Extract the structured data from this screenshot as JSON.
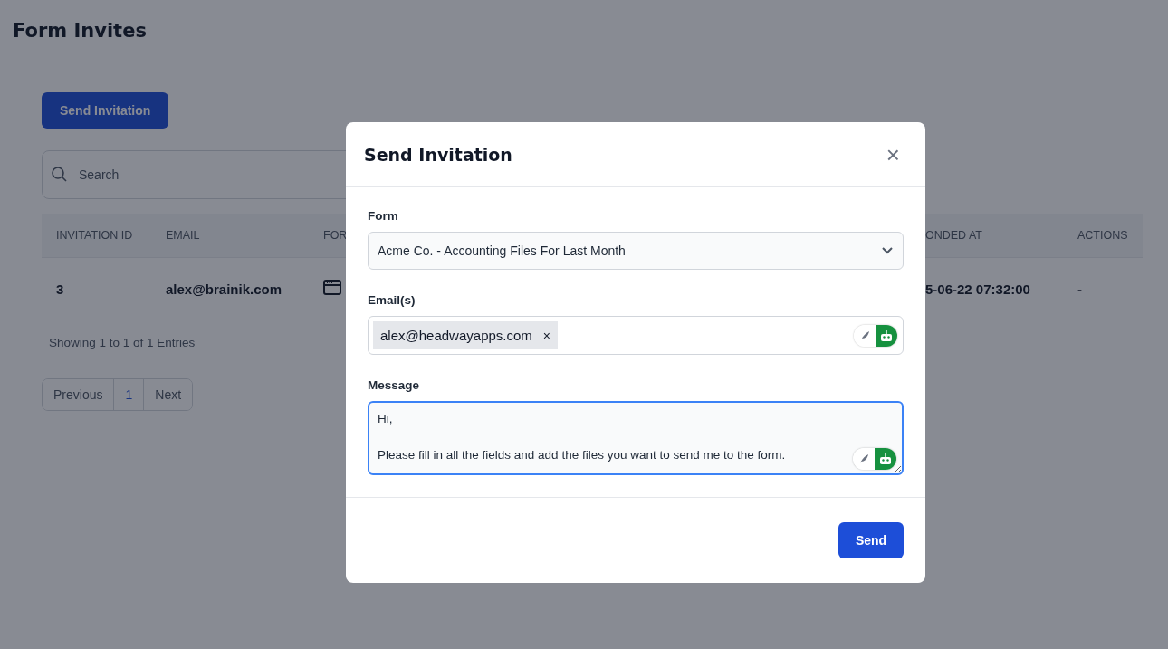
{
  "page": {
    "title": "Form Invites",
    "primary_button": "Send Invitation",
    "search": {
      "placeholder": "Search"
    }
  },
  "table": {
    "columns": [
      "INVITATION ID",
      "EMAIL",
      "FOR",
      "ONDED AT",
      "ACTIONS"
    ],
    "rows": [
      {
        "id": "3",
        "email": "alex@brainik.com",
        "responded_at": "5-06-22 07:32:00",
        "actions": "-"
      }
    ]
  },
  "summary": "Showing 1 to 1 of 1 Entries",
  "pagination": [
    {
      "label": "Previous",
      "selected": false
    },
    {
      "label": "1",
      "selected": true
    },
    {
      "label": "Next",
      "selected": false
    }
  ],
  "modal": {
    "title": "Send Invitation",
    "close": "×",
    "form_label": "Form",
    "form_value": "Acme Co. - Accounting Files For Last Month",
    "emails_label": "Email(s)",
    "emails_assistant_on": true,
    "message_assistant_on": true,
    "emails": [
      {
        "address": "alex@headwayapps.com",
        "remove": "×"
      }
    ],
    "message_label": "Message",
    "message": "Hi,\n\nPlease fill in all the fields and add the files you want to send me to the form.",
    "submit": "Send"
  }
}
